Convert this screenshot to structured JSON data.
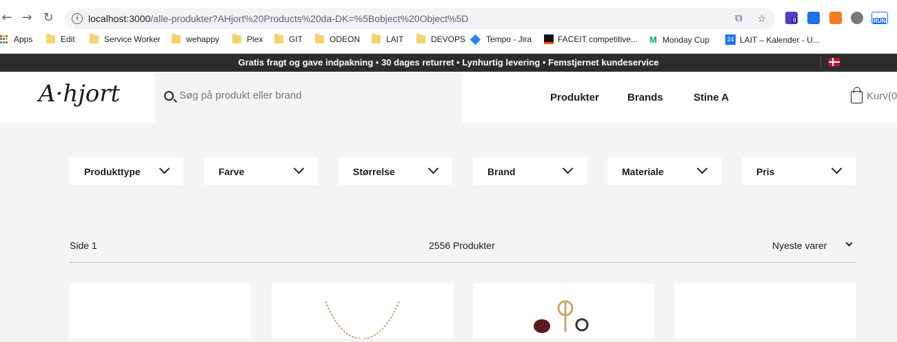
{
  "browser": {
    "url_host": "localhost:3000",
    "url_path": "/alle-produkter?AHjort%20Products%20da-DK=%5Bobject%20Object%5D",
    "back_icon": "arrow-left-icon",
    "forward_icon": "arrow-right-icon",
    "reload_icon": "reload-icon",
    "bookmarks": [
      {
        "label": "Apps",
        "icon": "apps-grid-icon"
      },
      {
        "label": "Edit",
        "icon": "folder-icon"
      },
      {
        "label": "Service Worker",
        "icon": "folder-icon"
      },
      {
        "label": "wehappy",
        "icon": "folder-icon"
      },
      {
        "label": "Plex",
        "icon": "folder-icon"
      },
      {
        "label": "GIT",
        "icon": "folder-icon"
      },
      {
        "label": "ODEON",
        "icon": "folder-icon"
      },
      {
        "label": "LAIT",
        "icon": "folder-icon"
      },
      {
        "label": "DEVOPS",
        "icon": "folder-icon"
      },
      {
        "label": "Tempo - Jira",
        "icon": "jira-icon"
      },
      {
        "label": "FACEIT competitive...",
        "icon": "faceit-icon"
      },
      {
        "label": "Monday Cup",
        "icon": "monday-icon"
      },
      {
        "label": "LAIT – Kalender - U...",
        "icon": "calendar-icon"
      }
    ],
    "ext_badge": "9",
    "ext_run": "RUN"
  },
  "promo": {
    "text": "Gratis fragt og gave indpakning • 30 dages returret • Lynhurtig levering • Femstjernet kundeservice"
  },
  "header": {
    "logo": "A·hjort",
    "search_placeholder": "Søg på produkt eller brand",
    "nav": [
      "Produkter",
      "Brands",
      "Stine A"
    ],
    "cart_label": "Kurv(0"
  },
  "filters": [
    "Produkttype",
    "Farve",
    "Størrelse",
    "Brand",
    "Materiale",
    "Pris"
  ],
  "results": {
    "page_label": "Side 1",
    "count_label": "2556 Produkter",
    "sort_label": "Nyeste varer"
  },
  "colors": {
    "promo_bg": "#2d2c2c",
    "page_bg": "#f5f4f2",
    "flag_red": "#c8102e"
  }
}
